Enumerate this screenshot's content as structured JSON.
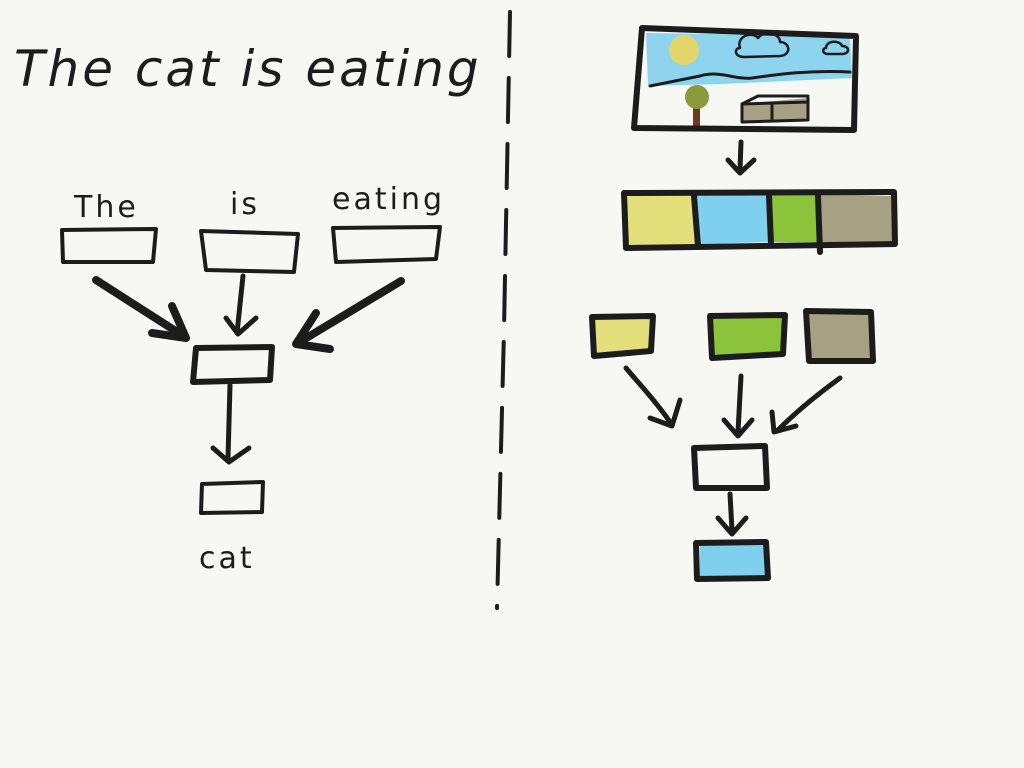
{
  "left_panel": {
    "title": "The cat is eating",
    "context_words": [
      "The",
      "is",
      "eating"
    ],
    "target_word": "cat"
  },
  "right_panel": {
    "patch_colors": [
      "#e3df7a",
      "#7fd0ef",
      "#8bc43a",
      "#a7a184"
    ],
    "selected_context_colors": [
      "#e3df7a",
      "#8bc43a",
      "#a7a184"
    ],
    "target_color": "#7fd0ef",
    "scene_colors": {
      "sky": "#8fd4ef",
      "sun": "#e3d56a",
      "tree_leaves": "#8b9a3a",
      "tree_trunk": "#6b3d1e",
      "house": "#a7a184"
    }
  },
  "ink_color": "#1c1c1c"
}
